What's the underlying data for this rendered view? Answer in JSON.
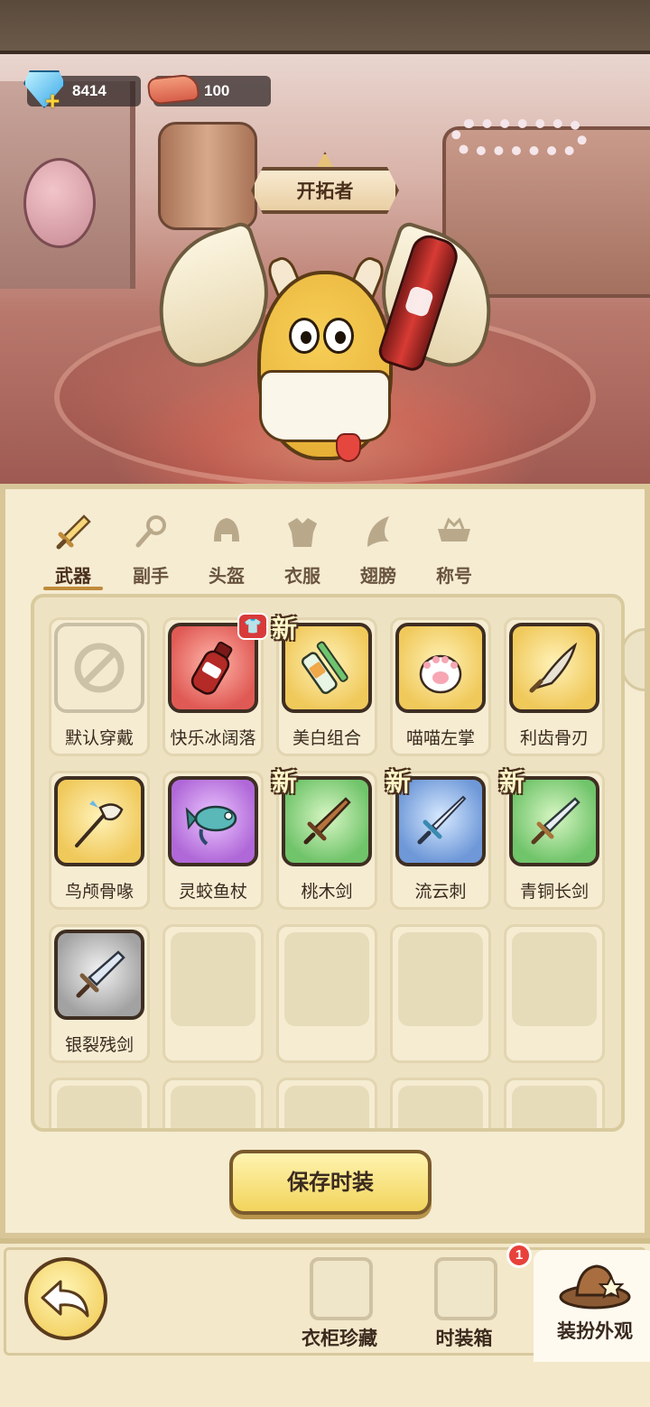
{
  "currency": {
    "gems": {
      "icon": "diamond-icon",
      "amount": "8414"
    },
    "meat": {
      "icon": "meat-icon",
      "amount": "100"
    }
  },
  "character": {
    "title": "开拓者"
  },
  "tabs": [
    {
      "label": "武器",
      "icon": "sword-icon",
      "active": true
    },
    {
      "label": "副手",
      "icon": "offhand-icon",
      "active": false
    },
    {
      "label": "头盔",
      "icon": "helmet-icon",
      "active": false
    },
    {
      "label": "衣服",
      "icon": "armor-icon",
      "active": false
    },
    {
      "label": "翅膀",
      "icon": "wing-icon",
      "active": false
    },
    {
      "label": "称号",
      "icon": "title-icon",
      "active": false
    }
  ],
  "items": [
    {
      "label": "默认穿戴",
      "rarity": "default",
      "is_new": false,
      "owned_badge": false
    },
    {
      "label": "快乐冰阔落",
      "rarity": "red",
      "is_new": false,
      "owned_badge": true
    },
    {
      "label": "美白组合",
      "rarity": "gold",
      "is_new": true,
      "owned_badge": false
    },
    {
      "label": "喵喵左掌",
      "rarity": "gold",
      "is_new": false,
      "owned_badge": false
    },
    {
      "label": "利齿骨刃",
      "rarity": "gold",
      "is_new": false,
      "owned_badge": false
    },
    {
      "label": "鸟颅骨喙",
      "rarity": "gold",
      "is_new": false,
      "owned_badge": false
    },
    {
      "label": "灵蛟鱼杖",
      "rarity": "purple",
      "is_new": false,
      "owned_badge": false
    },
    {
      "label": "桃木剑",
      "rarity": "green",
      "is_new": true,
      "owned_badge": false
    },
    {
      "label": "流云刺",
      "rarity": "blue",
      "is_new": true,
      "owned_badge": false
    },
    {
      "label": "青铜长剑",
      "rarity": "green",
      "is_new": true,
      "owned_badge": false
    },
    {
      "label": "银裂残剑",
      "rarity": "gray",
      "is_new": false,
      "owned_badge": false
    }
  ],
  "new_tag": "新",
  "save_button": {
    "label": "保存时装"
  },
  "bottom_nav": {
    "back_icon": "back-arrow-icon",
    "items": [
      {
        "label": "衣柜珍藏",
        "icon": "wardrobe-icon"
      },
      {
        "label": "时装箱",
        "icon": "fashion-chest-icon",
        "badge": "1"
      },
      {
        "label": "装扮外观",
        "icon": "hat-icon",
        "active": true
      }
    ]
  }
}
